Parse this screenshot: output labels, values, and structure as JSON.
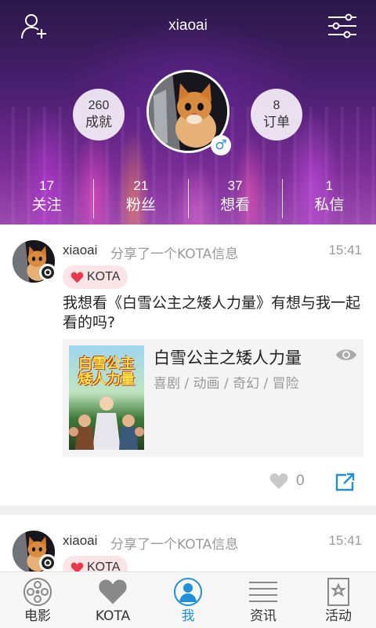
{
  "header": {
    "username": "xiaoai",
    "achievements": {
      "count": "260",
      "label": "成就"
    },
    "orders": {
      "count": "8",
      "label": "订单"
    },
    "gender_symbol": "♂",
    "stats": [
      {
        "count": "17",
        "label": "关注"
      },
      {
        "count": "21",
        "label": "粉丝"
      },
      {
        "count": "37",
        "label": "想看"
      },
      {
        "count": "1",
        "label": "私信"
      }
    ]
  },
  "feed": {
    "posts": [
      {
        "username": "xiaoai",
        "action": "分享了一个KOTA信息",
        "time": "15:41",
        "tag": "KOTA",
        "text": "我想看《白雪公主之矮人力量》有想与我一起看的吗?",
        "movie": {
          "title": "白雪公主之矮人力量",
          "genres": "喜剧 / 动画 / 奇幻 / 冒险",
          "poster_text": "白雪公主矮人力量"
        },
        "likes": "0"
      },
      {
        "username": "xiaoai",
        "action": "分享了一个KOTA信息",
        "time": "15:41",
        "tag": "KOTA"
      }
    ]
  },
  "bottom_nav": [
    {
      "label": "电影",
      "icon": "film-reel-icon"
    },
    {
      "label": "KOTA",
      "icon": "heart-icon"
    },
    {
      "label": "我",
      "icon": "user-profile-icon",
      "active": true
    },
    {
      "label": "资讯",
      "icon": "news-lines-icon"
    },
    {
      "label": "活动",
      "icon": "bookmark-star-icon"
    }
  ],
  "colors": {
    "accent": "#1e90dc",
    "heart": "#e8394c",
    "muted": "#999999"
  }
}
